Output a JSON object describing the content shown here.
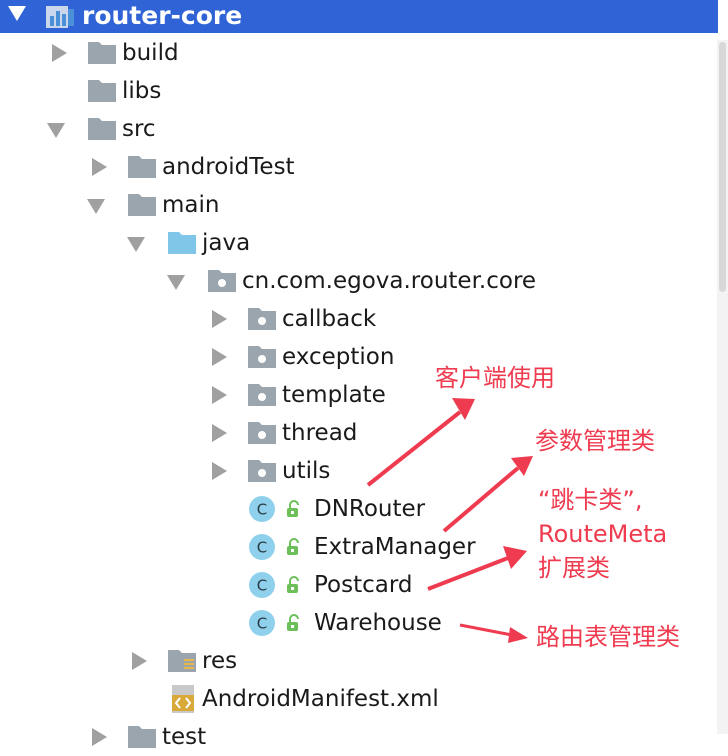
{
  "header": {
    "title": "router-core"
  },
  "tree": {
    "build": "build",
    "libs": "libs",
    "src": "src",
    "androidTest": "androidTest",
    "main": "main",
    "java": "java",
    "package": "cn.com.egova.router.core",
    "callback": "callback",
    "exception": "exception",
    "template": "template",
    "thread": "thread",
    "utils": "utils",
    "c1": "DNRouter",
    "c2": "ExtraManager",
    "c3": "Postcard",
    "c4": "Warehouse",
    "res": "res",
    "manifest": "AndroidManifest.xml",
    "test": "test"
  },
  "class_badge": "C",
  "annotations": {
    "a1": "客户端使用",
    "a2": "参数管理类",
    "a3_line1": "“跳卡类”,",
    "a3_line2": "RouteMeta",
    "a3_line3": "扩展类",
    "a4": "路由表管理类"
  },
  "colors": {
    "header_bg": "#2f63d6",
    "annotation": "#ef3b4f",
    "folder": "#9aa5ad",
    "java_folder": "#7fc6e8",
    "class_badge": "#8fd1ec"
  }
}
